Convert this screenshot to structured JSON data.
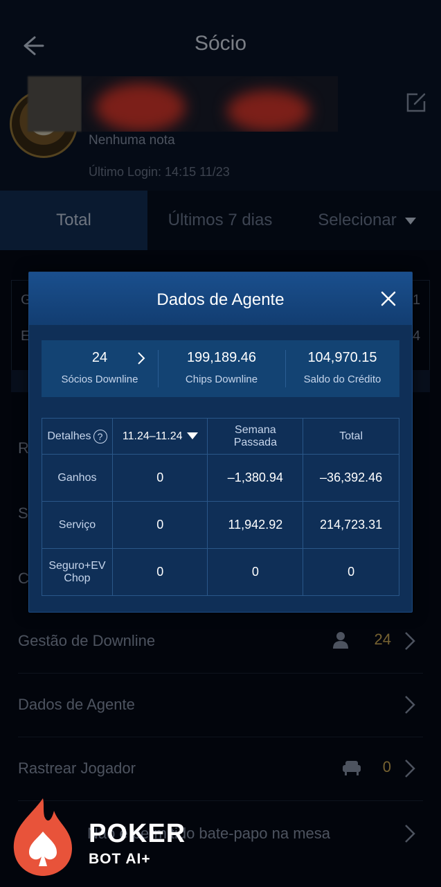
{
  "header": {
    "title": "Sócio"
  },
  "profile": {
    "note": "Nenhuma nota",
    "last_login": "Último Login: 14:15 11/23"
  },
  "tabs": [
    {
      "label": "Total"
    },
    {
      "label": "Últimos 7 dias"
    },
    {
      "label": "Selecionar"
    }
  ],
  "background_side": {
    "left_1": "G",
    "left_2": "E",
    "right_1": "1",
    "right_2": "4",
    "left_r": "R",
    "left_s": "S",
    "left_c": "C"
  },
  "list": [
    {
      "label": "Gestão de Downline",
      "count": "24"
    },
    {
      "label": "Dados de Agente"
    },
    {
      "label": "Rastrear Jogador",
      "count": "0"
    },
    {
      "label": "Não é permitido bate-papo na mesa"
    }
  ],
  "modal": {
    "title": "Dados de Agente",
    "summary": [
      {
        "value": "24",
        "label": "Sócios Downline"
      },
      {
        "value": "199,189.46",
        "label": "Chips Downline"
      },
      {
        "value": "104,970.15",
        "label": "Saldo do Crédito"
      }
    ],
    "table": {
      "headers": {
        "details": "Detalhes",
        "help": "?",
        "date": "11.24–11.24",
        "last_week_1": "Semana",
        "last_week_2": "Passada",
        "total": "Total"
      },
      "rows": [
        {
          "label": "Ganhos",
          "date": "0",
          "last_week": "–1,380.94",
          "total": "–36,392.46"
        },
        {
          "label": "Serviço",
          "date": "0",
          "last_week": "11,942.92",
          "total": "214,723.31"
        },
        {
          "label_1": "Seguro+EV",
          "label_2": "Chop",
          "date": "0",
          "last_week": "0",
          "total": "0"
        }
      ]
    }
  },
  "watermark": {
    "line1": "POKER",
    "line2": "BOT AI+"
  },
  "colors": {
    "accent_gold": "#d8b25a",
    "modal_bg": "#0f2f57",
    "page_bg": "#040a17"
  }
}
